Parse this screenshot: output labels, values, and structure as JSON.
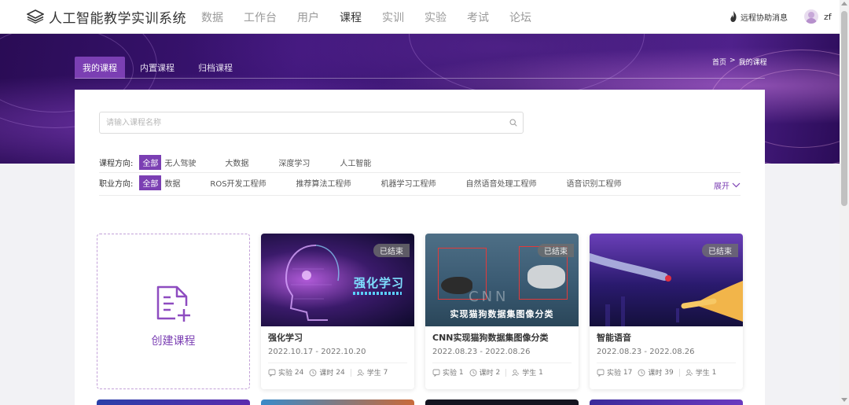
{
  "app": {
    "title": "人工智能教学实训系统"
  },
  "nav": {
    "items": [
      "数据",
      "工作台",
      "用户",
      "课程",
      "实训",
      "实验",
      "考试",
      "论坛"
    ],
    "active_index": 3
  },
  "header": {
    "help_label": "远程协助消息",
    "username": "zf"
  },
  "tabs": {
    "items": [
      "我的课程",
      "内置课程",
      "归档课程"
    ],
    "active_index": 0
  },
  "breadcrumb": {
    "home": "首页",
    "separator": ">",
    "current": "我的课程"
  },
  "search": {
    "placeholder": "请输入课程名称"
  },
  "filters": {
    "direction": {
      "label": "课程方向:",
      "options": [
        "全部",
        "无人驾驶",
        "大数据",
        "深度学习",
        "人工智能"
      ],
      "active_index": 0
    },
    "career": {
      "label": "职业方向:",
      "options": [
        "全部",
        "数据",
        "ROS开发工程师",
        "推荐算法工程师",
        "机器学习工程师",
        "自然语音处理工程师",
        "语音识别工程师"
      ],
      "active_index": 0
    },
    "expand_label": "展开"
  },
  "create_card": {
    "label": "创建课程"
  },
  "stat_labels": {
    "experiment": "实验",
    "hours": "课时",
    "students": "学生"
  },
  "courses": [
    {
      "title": "强化学习",
      "dates": "2022.10.17 - 2022.10.20",
      "badge": "已结束",
      "image_text": "强化学习",
      "experiments": "24",
      "hours": "24",
      "students": "7"
    },
    {
      "title": "CNN实现猫狗数据集图像分类",
      "dates": "2022.08.23 - 2022.08.26",
      "badge": "已结束",
      "image_text": "实现猫狗数据集图像分类",
      "image_text2": "CNN",
      "experiments": "1",
      "hours": "2",
      "students": "1"
    },
    {
      "title": "智能语音",
      "dates": "2022.08.23 - 2022.08.26",
      "badge": "已结束",
      "experiments": "17",
      "hours": "39",
      "students": "1"
    }
  ],
  "colors": {
    "accent": "#7b3fb3",
    "banner": "#3d1578"
  }
}
